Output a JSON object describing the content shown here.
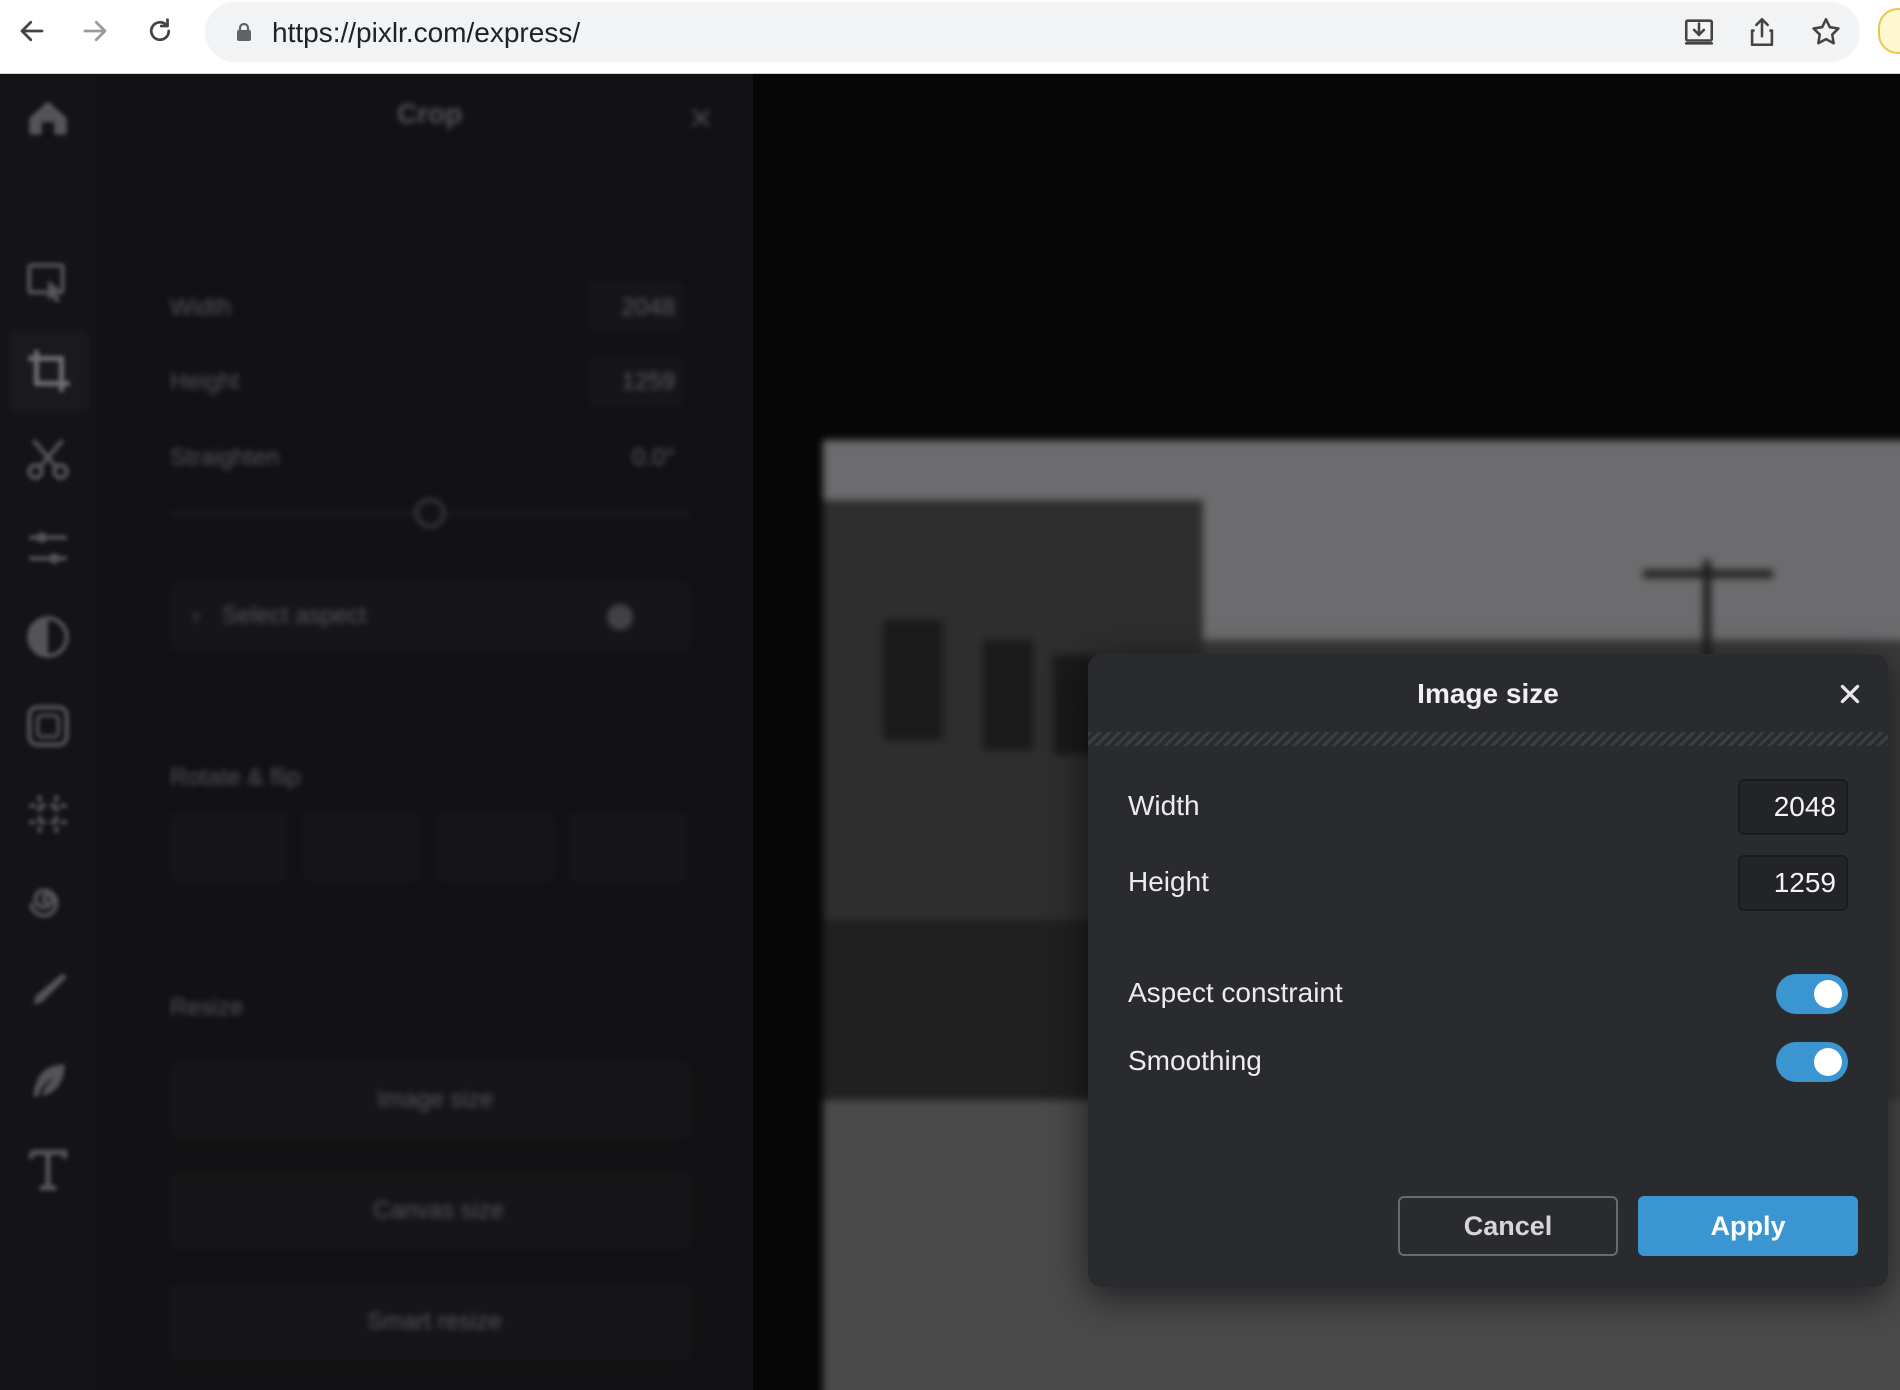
{
  "browser": {
    "url": "https://pixlr.com/express/",
    "icons": [
      "back-arrow-icon",
      "forward-arrow-icon",
      "reload-icon",
      "lock-icon",
      "install-icon",
      "share-icon",
      "bookmark-star-icon"
    ]
  },
  "panel": {
    "title": "Crop",
    "width_label": "Width",
    "width_value": "2048",
    "height_label": "Height",
    "height_value": "1259",
    "straighten_label": "Straighten",
    "straighten_value": "0.0°",
    "select_aspect_label": "Select aspect",
    "rotate_flip_label": "Rotate & flip",
    "resize_label": "Resize",
    "image_size_button": "Image size",
    "canvas_size_button": "Canvas size",
    "smart_resize_button": "Smart resize"
  },
  "modal": {
    "title": "Image size",
    "width_label": "Width",
    "width_value": "2048",
    "height_label": "Height",
    "height_value": "1259",
    "aspect_constraint_label": "Aspect constraint",
    "aspect_constraint_on": true,
    "smoothing_label": "Smoothing",
    "smoothing_on": true,
    "cancel_label": "Cancel",
    "apply_label": "Apply"
  },
  "colors": {
    "accent": "#3b95d0",
    "modal_bg": "#2a2b2f",
    "app_bg": "#0b0b0b"
  }
}
